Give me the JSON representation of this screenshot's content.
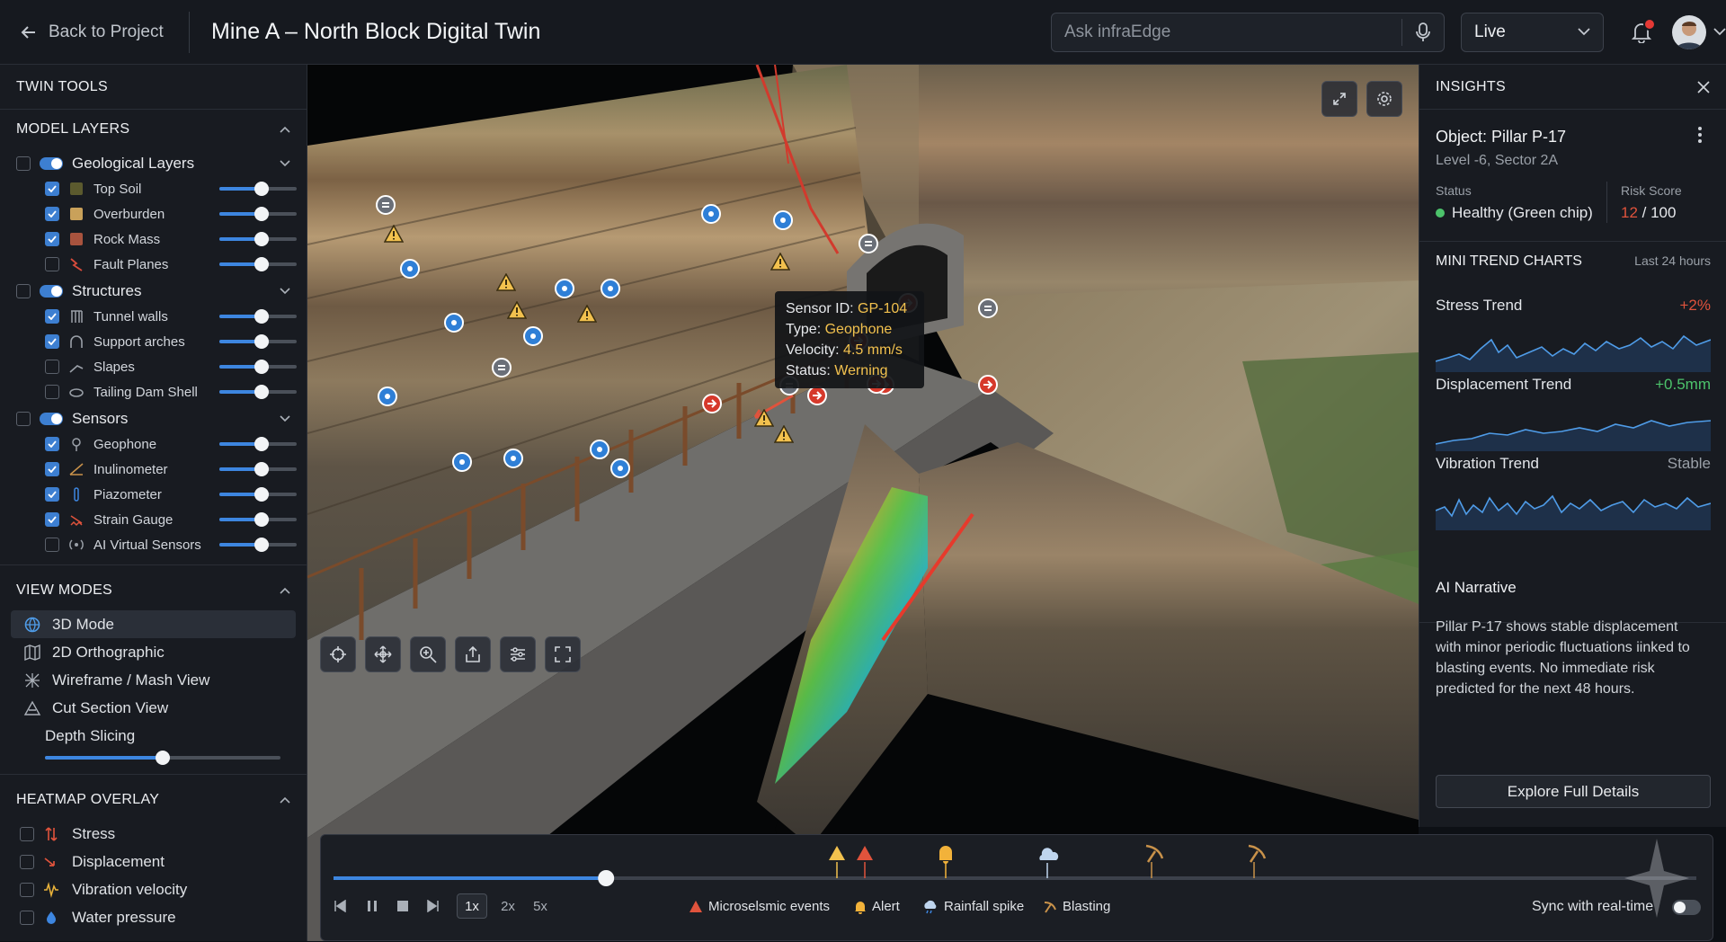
{
  "header": {
    "back_label": "Back to Project",
    "title": "Mine A – North Block Digital Twin",
    "search_placeholder": "Ask infraEdge",
    "mode_value": "Live"
  },
  "left_panel": {
    "title": "TWIN TOOLS",
    "model_layers": {
      "heading": "MODEL LAYERS",
      "groups": [
        {
          "label": "Geological Layers",
          "enabled": true,
          "items": [
            {
              "label": "Top Soil",
              "checked": true,
              "icon": "swatch-olive-icon",
              "color": "#5b5a2e",
              "opacity": 0.55
            },
            {
              "label": "Overburden",
              "checked": true,
              "icon": "swatch-tan-icon",
              "color": "#c9a15a",
              "opacity": 0.55
            },
            {
              "label": "Rock Mass",
              "checked": true,
              "icon": "swatch-rust-icon",
              "color": "#a8533e",
              "opacity": 0.55
            },
            {
              "label": "Fault Planes",
              "checked": false,
              "icon": "fault-line-icon",
              "color": "#d94b3b",
              "opacity": 0.55
            }
          ]
        },
        {
          "label": "Structures",
          "enabled": true,
          "items": [
            {
              "label": "Tunnel walls",
              "checked": true,
              "icon": "tunnel-walls-icon",
              "opacity": 0.55
            },
            {
              "label": "Support arches",
              "checked": true,
              "icon": "arch-icon",
              "opacity": 0.55
            },
            {
              "label": "Slapes",
              "checked": false,
              "icon": "slope-icon",
              "opacity": 0.55
            },
            {
              "label": "Tailing Dam Shell",
              "checked": false,
              "icon": "dam-shell-icon",
              "opacity": 0.55
            }
          ]
        },
        {
          "label": "Sensors",
          "enabled": true,
          "items": [
            {
              "label": "Geophone",
              "checked": true,
              "icon": "geophone-icon",
              "opacity": 0.55
            },
            {
              "label": "Inulinometer",
              "checked": true,
              "icon": "inclinometer-icon",
              "opacity": 0.55
            },
            {
              "label": "Piazometer",
              "checked": true,
              "icon": "piezometer-icon",
              "opacity": 0.55
            },
            {
              "label": "Strain Gauge",
              "checked": true,
              "icon": "strain-gauge-icon",
              "opacity": 0.55
            },
            {
              "label": "AI Virtual Sensors",
              "checked": false,
              "icon": "ai-sensor-icon",
              "opacity": 0.55
            }
          ]
        }
      ]
    },
    "view_modes": {
      "heading": "VIEW MODES",
      "items": [
        {
          "label": "3D Mode",
          "icon": "globe-icon",
          "selected": true
        },
        {
          "label": "2D Orthographic",
          "icon": "map-icon",
          "selected": false
        },
        {
          "label": "Wireframe / Mash View",
          "icon": "wireframe-icon",
          "selected": false
        },
        {
          "label": "Cut Section View",
          "icon": "cut-section-icon",
          "selected": false
        }
      ],
      "depth_label": "Depth Slicing",
      "depth_value": 0.5
    },
    "heatmap": {
      "heading": "HEATMAP OVERLAY",
      "items": [
        {
          "label": "Stress",
          "icon": "stress-arrows-icon",
          "color": "#e0533c"
        },
        {
          "label": "Displacement",
          "icon": "displacement-arrow-icon",
          "color": "#e0533c"
        },
        {
          "label": "Vibration velocity",
          "icon": "vibration-wave-icon",
          "color": "#e8b23a"
        },
        {
          "label": "Water pressure",
          "icon": "water-drop-icon",
          "color": "#3d86e0"
        }
      ]
    }
  },
  "viewport": {
    "tooltip": {
      "id_label": "Sensor ID:",
      "id_value": "GP-104",
      "type_label": "Type:",
      "type_value": "Geophone",
      "velocity_label": "Velocity:",
      "velocity_value": "4.5 mm/s",
      "status_label": "Status:",
      "status_value": "Werning"
    },
    "tools": [
      "crosshair-icon",
      "move-icon",
      "zoom-in-icon",
      "share-icon",
      "sliders-icon",
      "fullscreen-icon"
    ]
  },
  "timeline": {
    "progress": 0.2,
    "speeds": [
      "1x",
      "2x",
      "5x"
    ],
    "active_speed": "1x",
    "legend": [
      {
        "label": "Microselsmic events",
        "icon": "warning-red-icon"
      },
      {
        "label": "Alert",
        "icon": "bell-icon"
      },
      {
        "label": "Rainfall spike",
        "icon": "rain-cloud-icon"
      },
      {
        "label": "Blasting",
        "icon": "pickaxe-icon"
      }
    ],
    "sync_label": "Sync with real-time",
    "sync_on": false
  },
  "insights": {
    "title": "INSIGHTS",
    "object": "Object: Pillar P-17",
    "location": "Level -6, Sector 2A",
    "status_label": "Status",
    "status_value": "Healthy (Green chip)",
    "risk_label": "Risk Score",
    "risk_value": "12",
    "risk_max": "/ 100",
    "trends_heading": "MINI TREND CHARTS",
    "trends_period": "Last 24 hours",
    "trends": [
      {
        "label": "Stress Trend",
        "delta": "+2%",
        "delta_color": "#e0533c"
      },
      {
        "label": "Displacement Trend",
        "delta": "+0.5mm",
        "delta_color": "#4cc36b"
      },
      {
        "label": "Vibration Trend",
        "delta": "Stable",
        "delta_color": "#9aa0a8"
      }
    ],
    "narrative_heading": "AI Narrative",
    "narrative_text": "Pillar P-17 shows stable displacement with minor periodic fluctuations iinked to blasting events. No immediate risk predicted for the next 48 hours.",
    "button_label": "Explore Full Details"
  },
  "colors": {
    "accent": "#3d86e0",
    "danger": "#e0533c",
    "warning": "#f2c14e",
    "success": "#4cc36b"
  }
}
